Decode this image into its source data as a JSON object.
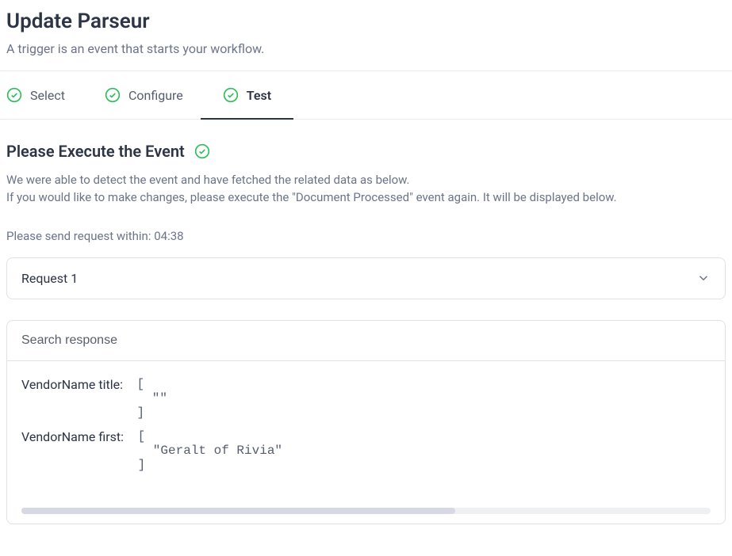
{
  "header": {
    "title": "Update Parseur",
    "subtitle": "A trigger is an event that starts your workflow."
  },
  "tabs": [
    {
      "label": "Select"
    },
    {
      "label": "Configure"
    },
    {
      "label": "Test"
    }
  ],
  "section": {
    "title": "Please Execute the Event",
    "desc_line1": "We were able to detect the event and have fetched the related data as below.",
    "desc_line2": "If you would like to make changes, please execute the \"Document Processed\" event again. It will be displayed below."
  },
  "timer": {
    "prefix": "Please send request within: ",
    "value": "04:38"
  },
  "selector": {
    "selected": "Request 1"
  },
  "search": {
    "placeholder": "Search response"
  },
  "response": {
    "items": [
      {
        "key": "VendorName title:",
        "val": " [\n   \"\"\n ]"
      },
      {
        "key": "VendorName first:",
        "val": " [\n   \"Geralt of Rivia\"\n ]"
      }
    ]
  }
}
